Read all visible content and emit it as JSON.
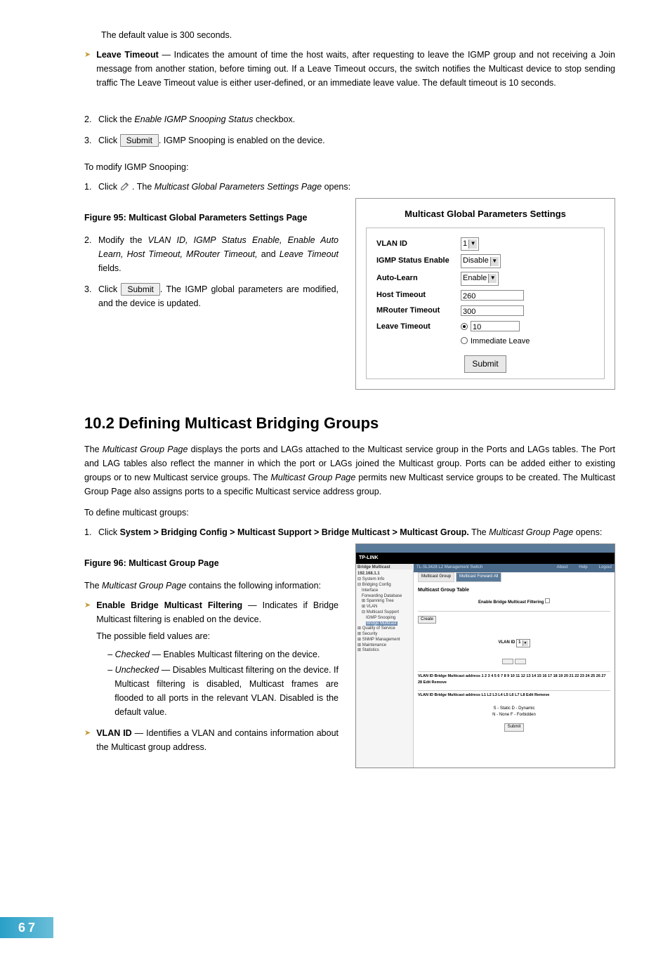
{
  "intro_trailing": "The default value is 300 seconds.",
  "leave_timeout_label": "Leave Timeout",
  "leave_timeout_body": " — Indicates the amount of time the host waits, after requesting to leave the IGMP group and not receiving a Join message from another station, before timing out. If a Leave Timeout occurs, the switch notifies the Multicast device to stop sending traffic The Leave Timeout value is either user-defined, or an immediate leave value. The default timeout is 10 seconds.",
  "step2_num": "2.",
  "step2_a": "Click the ",
  "step2_i": "Enable IGMP Snooping Status",
  "step2_b": " checkbox.",
  "step3_num": "3.",
  "step3_a": "Click ",
  "submit_btn": "Submit",
  "step3_b": ". IGMP Snooping is enabled on the device.",
  "modify_heading": "To modify IGMP Snooping:",
  "mod1_num": "1.",
  "mod1_a": "Click  ",
  "mod1_b": " . The ",
  "mod1_i": "Multicast Global Parameters Settings Page",
  "mod1_c": " opens:",
  "fig95_caption": "Figure 95: Multicast Global Parameters Settings Page",
  "mod2_num": "2.",
  "mod2_a": "Modify the ",
  "mod2_i": "VLAN ID, IGMP Status Enable, Enable Auto Learn, Host Timeout, MRouter Timeout,",
  "mod2_b": " and ",
  "mod2_i2": "Leave Timeout",
  "mod2_c": " fields.",
  "mod3_num": "3.",
  "mod3_a": "Click ",
  "mod3_b": ". The IGMP global parameters are modified, and the device is updated.",
  "panel": {
    "title": "Multicast Global Parameters Settings",
    "vlan_label": "VLAN ID",
    "vlan_value": "1",
    "igmp_label": "IGMP Status Enable",
    "igmp_value": "Disable",
    "auto_label": "Auto-Learn",
    "auto_value": "Enable",
    "host_label": "Host Timeout",
    "host_value": "260",
    "mrouter_label": "MRouter Timeout",
    "mrouter_value": "300",
    "leave_label": "Leave Timeout",
    "leave_value": "10",
    "leave_immediate": "Immediate Leave",
    "submit": "Submit"
  },
  "section_heading": "10.2  Defining Multicast Bridging Groups",
  "sec_para1a": "The ",
  "sec_para1i": "Multicast Group Page",
  "sec_para1b": " displays the ports and LAGs attached to the Multicast service group in the Ports and LAGs tables. The Port and LAG tables also reflect the manner in which the port or LAGs joined the Multicast group. Ports can be added either to existing groups or to new Multicast service groups. The ",
  "sec_para1i2": "Multicast Group Page",
  "sec_para1c": " permits new Multicast service groups to be created. The Multicast Group Page also assigns ports to a specific Multicast service address group.",
  "define_heading": "To define multicast groups:",
  "def1_num": "1.",
  "def1_a": "Click ",
  "def1_strong": "System > Bridging Config > Multicast Support > Bridge Multicast > Multicast Group.",
  "def1_b": " The ",
  "def1_i": "Multicast Group Page",
  "def1_c": " opens:",
  "fig96_caption": "Figure 96: Multicast Group Page",
  "mg_desc_a": "The ",
  "mg_desc_i": "Multicast Group Page",
  "mg_desc_b": " contains the following information:",
  "ebmf_label": "Enable Bridge Multicast Filtering",
  "ebmf_body": " — Indicates if Bridge Multicast filtering is enabled on the device.",
  "ebmf_sub": "The possible field values are:",
  "ebmf_checked_i": "Checked",
  "ebmf_checked_b": " — Enables Multicast filtering on the device.",
  "ebmf_unchecked_i": "Unchecked",
  "ebmf_unchecked_b": " — Disables Multicast filtering on the device. If Multicast filtering is disabled, Multicast frames are flooded to all ports in the relevant VLAN. Disabled is the default value.",
  "vlanid_label": "VLAN ID",
  "vlanid_body": " — Identifies a VLAN and contains information about the Multicast group address.",
  "mg_shot": {
    "brand": "TP-LINK",
    "side_title": "Bridge Multicast",
    "header_sub": "TL-SL3428 L2 Management Switch",
    "about": "About",
    "help": "Help",
    "logout": "Logout",
    "tab1": "Multicast Group",
    "tab2": "Multicast Forward All",
    "tree_root": "192.168.1.1",
    "tree1": "System Info",
    "tree2": "Bridging Config",
    "tree2a": "Interface",
    "tree2b": "Forwarding Database",
    "tree2c": "Spanning Tree",
    "tree2d": "VLAN",
    "tree2e": "Multicast Support",
    "tree2e1": "IGMP Snooping",
    "tree2e2": "Bridge Multicast",
    "tree3": "Quality of Service",
    "tree4": "Security",
    "tree5": "SNMP Management",
    "tree6": "Maintenance",
    "tree7": "Statistics",
    "main_title": "Multicast Group Table",
    "enable_label": "Enable Bridge Multicast Filtering",
    "create": "Create",
    "vlanid_sel": "VLAN ID",
    "vlanid_opt": "1",
    "ports_header": "VLAN ID Bridge Multicast address  1  2  3  4  5  6  7  8  9 10 11 12 13 14 15 16 17 18 19 20 21 22 23 24 25 26 27 28 Edit Remove",
    "lags_header": "VLAN ID Bridge Multicast address  L1  L2  L3  L4  L5  L6  L7  L8  Edit Remove",
    "legend": "S - Static  D - Dynamic",
    "legend2": "N - None  F - Forbidden",
    "submit": "Submit"
  },
  "page_number": "67"
}
